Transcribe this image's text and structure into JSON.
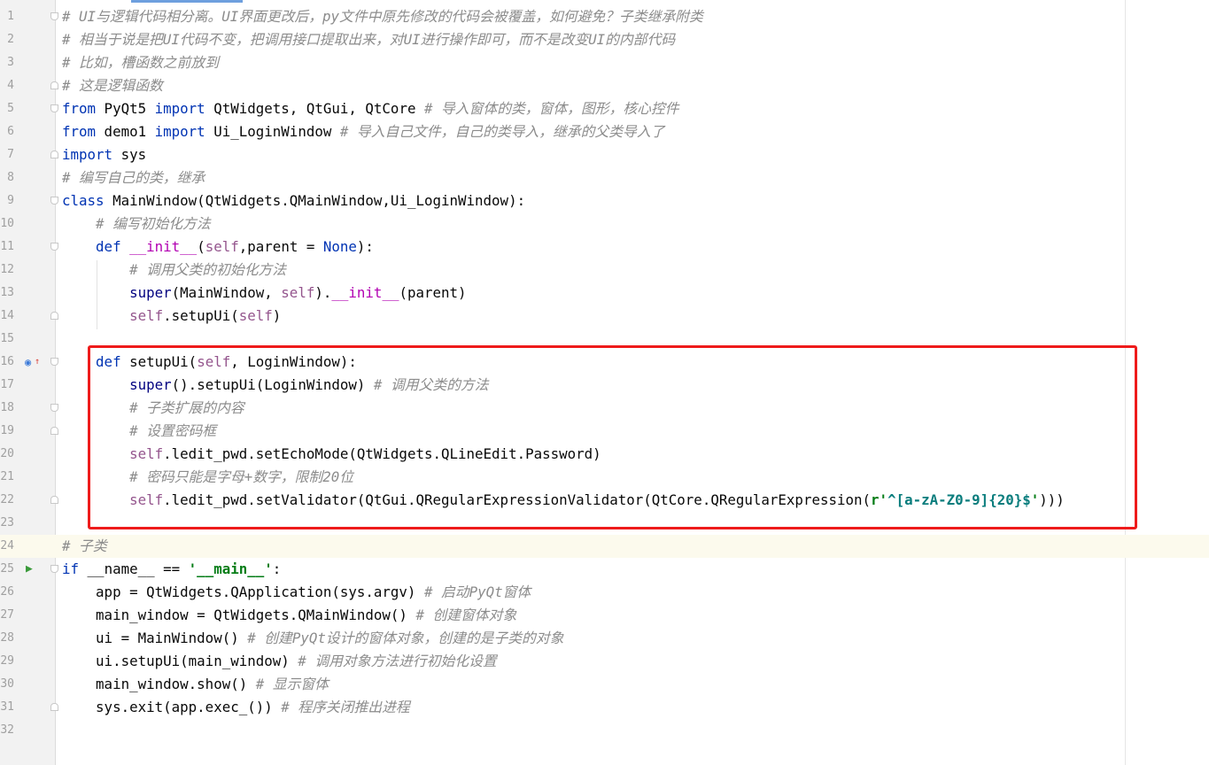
{
  "editor": {
    "lines": [
      {
        "n": "1",
        "fold": "start",
        "tokens": [
          {
            "t": "# UI与逻辑代码相分离。UI界面更改后，py文件中原先修改的代码会被覆盖，如何避免？子类继承附类",
            "c": "com"
          }
        ]
      },
      {
        "n": "2",
        "tokens": [
          {
            "t": "# 相当于说是把UI代码不变，把调用接口提取出来，对UI进行操作即可，而不是改变UI的内部代码",
            "c": "com"
          }
        ]
      },
      {
        "n": "3",
        "tokens": [
          {
            "t": "# 比如，槽函数之前放到",
            "c": "com"
          }
        ]
      },
      {
        "n": "4",
        "fold": "end",
        "tokens": [
          {
            "t": "# 这是逻辑函数",
            "c": "com"
          }
        ]
      },
      {
        "n": "5",
        "fold": "start",
        "tokens": [
          {
            "t": "from",
            "c": "kw"
          },
          {
            "t": " PyQt5 ",
            "c": "plain"
          },
          {
            "t": "import",
            "c": "kw"
          },
          {
            "t": " QtWidgets, QtGui, QtCore ",
            "c": "plain"
          },
          {
            "t": "# 导入窗体的类，窗体，图形，核心控件",
            "c": "com"
          }
        ]
      },
      {
        "n": "6",
        "tokens": [
          {
            "t": "from",
            "c": "kw"
          },
          {
            "t": " demo1 ",
            "c": "plain"
          },
          {
            "t": "import",
            "c": "kw"
          },
          {
            "t": " Ui_LoginWindow ",
            "c": "plain"
          },
          {
            "t": "# 导入自己文件，自己的类导入，继承的父类导入了",
            "c": "com"
          }
        ]
      },
      {
        "n": "7",
        "fold": "end",
        "tokens": [
          {
            "t": "import",
            "c": "kw"
          },
          {
            "t": " sys",
            "c": "plain"
          }
        ]
      },
      {
        "n": "8",
        "tokens": [
          {
            "t": "# 编写自己的类，继承",
            "c": "com"
          }
        ]
      },
      {
        "n": "9",
        "fold": "start",
        "tokens": [
          {
            "t": "class",
            "c": "kw"
          },
          {
            "t": " MainWindow(QtWidgets.QMainWindow,Ui_LoginWindow):",
            "c": "plain"
          }
        ]
      },
      {
        "n": "10",
        "tokens": [
          {
            "t": "    ",
            "c": "plain"
          },
          {
            "t": "# 编写初始化方法",
            "c": "com"
          }
        ]
      },
      {
        "n": "11",
        "fold": "start",
        "tokens": [
          {
            "t": "    ",
            "c": "plain"
          },
          {
            "t": "def",
            "c": "kw"
          },
          {
            "t": " ",
            "c": "plain"
          },
          {
            "t": "__init__",
            "c": "dun"
          },
          {
            "t": "(",
            "c": "plain"
          },
          {
            "t": "self",
            "c": "self"
          },
          {
            "t": ",parent = ",
            "c": "plain"
          },
          {
            "t": "None",
            "c": "kw"
          },
          {
            "t": "):",
            "c": "plain"
          }
        ]
      },
      {
        "n": "12",
        "tokens": [
          {
            "t": "        ",
            "c": "plain"
          },
          {
            "t": "# 调用父类的初始化方法",
            "c": "com"
          }
        ]
      },
      {
        "n": "13",
        "tokens": [
          {
            "t": "        ",
            "c": "plain"
          },
          {
            "t": "super",
            "c": "bi"
          },
          {
            "t": "(MainWindow, ",
            "c": "plain"
          },
          {
            "t": "self",
            "c": "self"
          },
          {
            "t": ").",
            "c": "plain"
          },
          {
            "t": "__init__",
            "c": "dun"
          },
          {
            "t": "(parent)",
            "c": "plain"
          }
        ]
      },
      {
        "n": "14",
        "fold": "end",
        "tokens": [
          {
            "t": "        ",
            "c": "plain"
          },
          {
            "t": "self",
            "c": "self"
          },
          {
            "t": ".setupUi(",
            "c": "plain"
          },
          {
            "t": "self",
            "c": "self"
          },
          {
            "t": ")",
            "c": "plain"
          }
        ]
      },
      {
        "n": "15",
        "tokens": []
      },
      {
        "n": "16",
        "fold": "start",
        "override": true,
        "tokens": [
          {
            "t": "    ",
            "c": "plain"
          },
          {
            "t": "def",
            "c": "kw"
          },
          {
            "t": " setupUi(",
            "c": "plain"
          },
          {
            "t": "self",
            "c": "self"
          },
          {
            "t": ", LoginWindow):",
            "c": "plain"
          }
        ]
      },
      {
        "n": "17",
        "tokens": [
          {
            "t": "        ",
            "c": "plain"
          },
          {
            "t": "super",
            "c": "bi"
          },
          {
            "t": "().setupUi(LoginWindow) ",
            "c": "plain"
          },
          {
            "t": "# 调用父类的方法",
            "c": "com"
          }
        ]
      },
      {
        "n": "18",
        "fold": "start",
        "tokens": [
          {
            "t": "        ",
            "c": "plain"
          },
          {
            "t": "# 子类扩展的内容",
            "c": "com"
          }
        ]
      },
      {
        "n": "19",
        "fold": "end",
        "tokens": [
          {
            "t": "        ",
            "c": "plain"
          },
          {
            "t": "# 设置密码框",
            "c": "com"
          }
        ]
      },
      {
        "n": "20",
        "tokens": [
          {
            "t": "        ",
            "c": "plain"
          },
          {
            "t": "self",
            "c": "self"
          },
          {
            "t": ".ledit_pwd.setEchoMode(QtWidgets.QLineEdit.Password)",
            "c": "plain"
          }
        ]
      },
      {
        "n": "21",
        "tokens": [
          {
            "t": "        ",
            "c": "plain"
          },
          {
            "t": "# 密码只能是字母+数字，限制20位",
            "c": "com"
          }
        ]
      },
      {
        "n": "22",
        "fold": "end",
        "tokens": [
          {
            "t": "        ",
            "c": "plain"
          },
          {
            "t": "self",
            "c": "self"
          },
          {
            "t": ".ledit_pwd.setValidator(QtGui.QRegularExpressionValidator(QtCore.QRegularExpression(",
            "c": "plain"
          },
          {
            "t": "r'",
            "c": "str"
          },
          {
            "t": "^[a-zA-Z0-9]{20}$",
            "c": "reg"
          },
          {
            "t": "'",
            "c": "str"
          },
          {
            "t": ")))",
            "c": "plain"
          }
        ]
      },
      {
        "n": "23",
        "tokens": []
      },
      {
        "n": "24",
        "current": true,
        "tokens": [
          {
            "t": "# 子类",
            "c": "com"
          }
        ]
      },
      {
        "n": "25",
        "fold": "start",
        "run": true,
        "tokens": [
          {
            "t": "if",
            "c": "kw"
          },
          {
            "t": " __name__ == ",
            "c": "plain"
          },
          {
            "t": "'__main__'",
            "c": "str"
          },
          {
            "t": ":",
            "c": "plain"
          }
        ]
      },
      {
        "n": "26",
        "tokens": [
          {
            "t": "    app = QtWidgets.QApplication(sys.argv) ",
            "c": "plain"
          },
          {
            "t": "# 启动PyQt窗体",
            "c": "com"
          }
        ]
      },
      {
        "n": "27",
        "tokens": [
          {
            "t": "    main_window = QtWidgets.QMainWindow() ",
            "c": "plain"
          },
          {
            "t": "# 创建窗体对象",
            "c": "com"
          }
        ]
      },
      {
        "n": "28",
        "tokens": [
          {
            "t": "    ui = MainWindow() ",
            "c": "plain"
          },
          {
            "t": "# 创建PyQt设计的窗体对象，创建的是子类的对象",
            "c": "com"
          }
        ]
      },
      {
        "n": "29",
        "tokens": [
          {
            "t": "    ui.setupUi(main_window) ",
            "c": "plain"
          },
          {
            "t": "# 调用对象方法进行初始化设置",
            "c": "com"
          }
        ]
      },
      {
        "n": "30",
        "tokens": [
          {
            "t": "    main_window.show() ",
            "c": "plain"
          },
          {
            "t": "# 显示窗体",
            "c": "com"
          }
        ]
      },
      {
        "n": "31",
        "fold": "end",
        "tokens": [
          {
            "t": "    sys.exit(app.exec_()) ",
            "c": "plain"
          },
          {
            "t": "# 程序关闭推出进程",
            "c": "com"
          }
        ]
      },
      {
        "n": "32",
        "tokens": []
      }
    ]
  },
  "icons": {
    "override": "override-method-icon",
    "run": "run-arrow-icon"
  },
  "colors": {
    "highlight_box": "#ee1b1b",
    "keyword": "#0033b3",
    "comment": "#8c8c8c",
    "self": "#94558d",
    "string": "#067d17"
  }
}
